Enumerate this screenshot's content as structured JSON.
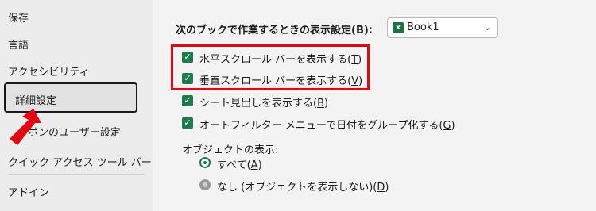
{
  "sidebar": {
    "items": [
      {
        "label": "保存"
      },
      {
        "label": "言語"
      },
      {
        "label": "アクセシビリティ"
      },
      {
        "label": "詳細設定"
      },
      {
        "label": "リボンのユーザー設定"
      },
      {
        "label": "クイック アクセス ツール バー"
      },
      {
        "label": "アドイン"
      }
    ]
  },
  "main": {
    "section_label": "次のブックで作業するときの表示設定(B):",
    "workbook_select": {
      "value": "Book1",
      "icon": "excel-icon"
    },
    "options": [
      {
        "label": "水平スクロール バーを表示する(",
        "key": "T",
        "suffix": ")",
        "checked": true
      },
      {
        "label": "垂直スクロール バーを表示する(",
        "key": "V",
        "suffix": ")",
        "checked": true
      },
      {
        "label": "シート見出しを表示する(",
        "key": "B",
        "suffix": ")",
        "checked": true
      },
      {
        "label": "オートフィルター メニューで日付をグループ化する(",
        "key": "G",
        "suffix": ")",
        "checked": true
      }
    ],
    "objects_label": "オブジェクトの表示:",
    "radios": [
      {
        "label": "すべて(",
        "key": "A",
        "suffix": ")",
        "selected": true
      },
      {
        "label": "なし (オブジェクトを表示しない)(",
        "key": "D",
        "suffix": ")",
        "selected": false
      }
    ]
  },
  "colors": {
    "accent": "#1f7a4d",
    "highlight_box": "#e30613",
    "arrow": "#e30613"
  }
}
